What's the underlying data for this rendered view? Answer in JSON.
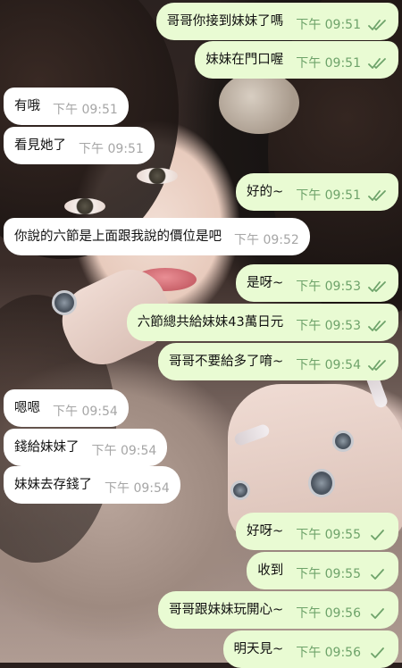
{
  "messages": [
    {
      "dir": "out",
      "text": "哥哥你接到妹妹了嗎",
      "time": "下午 09:51",
      "status": "read"
    },
    {
      "dir": "out",
      "text": "妹妹在門口喔",
      "time": "下午 09:51",
      "status": "read"
    },
    {
      "dir": "in",
      "text": "有哦",
      "time": "下午 09:51"
    },
    {
      "dir": "in",
      "text": "看見她了",
      "time": "下午 09:51"
    },
    {
      "dir": "out",
      "text": "好的~",
      "time": "下午 09:51",
      "status": "read"
    },
    {
      "dir": "in",
      "text": "你說的六節是上面跟我說的價位是吧",
      "time": "下午 09:52"
    },
    {
      "dir": "out",
      "text": "是呀~",
      "time": "下午 09:53",
      "status": "read"
    },
    {
      "dir": "out",
      "text": "六節總共給妹妹43萬日元",
      "time": "下午 09:53",
      "status": "read"
    },
    {
      "dir": "out",
      "text": "哥哥不要給多了唷~",
      "time": "下午 09:54",
      "status": "read"
    },
    {
      "dir": "in",
      "text": "嗯嗯",
      "time": "下午 09:54"
    },
    {
      "dir": "in",
      "text": "錢給妹妹了",
      "time": "下午 09:54"
    },
    {
      "dir": "in",
      "text": "妹妹去存錢了",
      "time": "下午 09:54"
    },
    {
      "dir": "out",
      "text": "好呀~",
      "time": "下午 09:55",
      "status": "sent"
    },
    {
      "dir": "out",
      "text": "收到",
      "time": "下午 09:55",
      "status": "sent"
    },
    {
      "dir": "out",
      "text": "哥哥跟妹妹玩開心~",
      "time": "下午 09:56",
      "status": "sent"
    },
    {
      "dir": "out",
      "text": "明天見~",
      "time": "下午 09:56",
      "status": "sent"
    }
  ],
  "colors": {
    "outgoing_bubble": "#e9fbd3",
    "incoming_bubble": "#ffffff",
    "outgoing_time": "#6ea36a",
    "incoming_time": "#a6a6a6",
    "check": "#6ea36a"
  },
  "icons": {
    "read": "double-check-icon",
    "sent": "single-check-icon"
  }
}
